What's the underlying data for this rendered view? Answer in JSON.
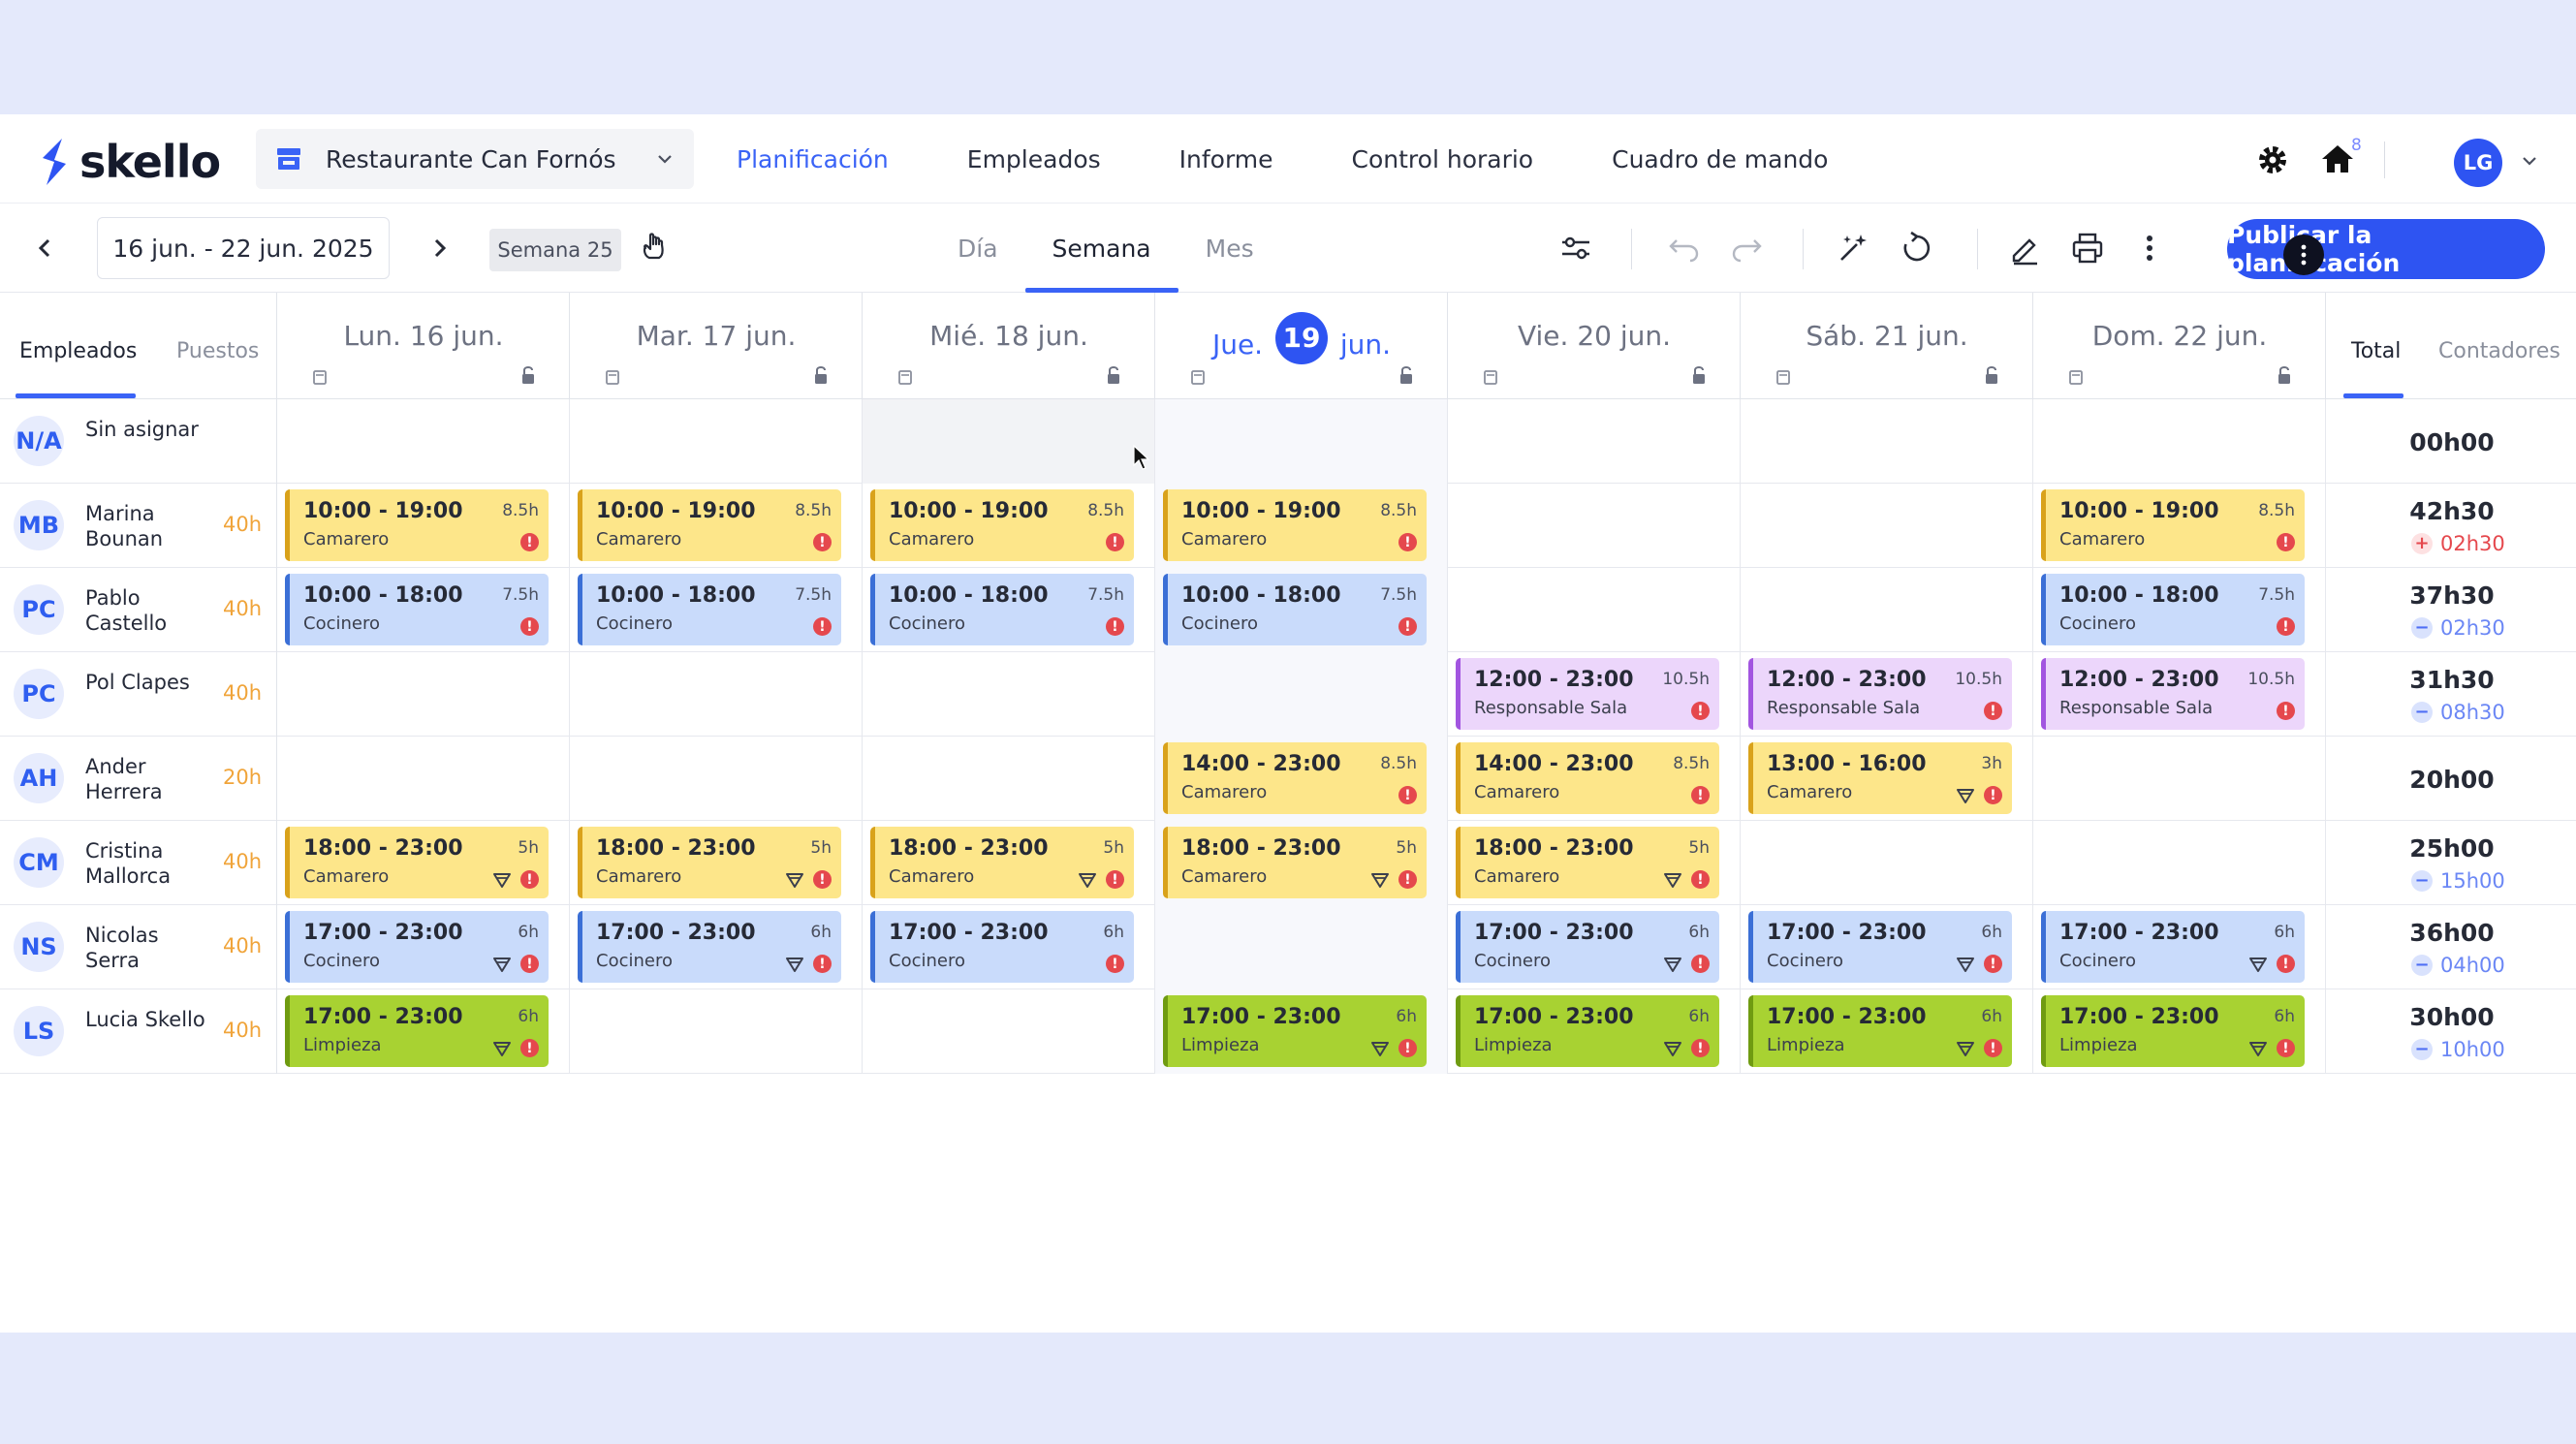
{
  "brand": {
    "name": "skello"
  },
  "store": {
    "name": "Restaurante Can Fornós"
  },
  "nav": [
    {
      "label": "Planificación",
      "active": true
    },
    {
      "label": "Empleados",
      "active": false
    },
    {
      "label": "Informe",
      "active": false
    },
    {
      "label": "Control horario",
      "active": false
    },
    {
      "label": "Cuadro de mando",
      "active": false
    }
  ],
  "notifications": {
    "count": "8"
  },
  "user": {
    "initials": "LG"
  },
  "toolbar": {
    "date_range": "16 jun. - 22 jun. 2025",
    "week": "Semana 25",
    "views": [
      {
        "label": "Día",
        "active": false
      },
      {
        "label": "Semana",
        "active": true
      },
      {
        "label": "Mes",
        "active": false
      }
    ],
    "publish_label": "Publicar la planificación"
  },
  "left_tabs": [
    {
      "label": "Empleados",
      "active": true
    },
    {
      "label": "Puestos",
      "active": false
    }
  ],
  "right_tabs": [
    {
      "label": "Total",
      "active": true
    },
    {
      "label": "Contadores",
      "active": false
    }
  ],
  "days": [
    {
      "name": "Lun.",
      "num": "16",
      "month": "jun.",
      "today": false
    },
    {
      "name": "Mar.",
      "num": "17",
      "month": "jun.",
      "today": false
    },
    {
      "name": "Mié.",
      "num": "18",
      "month": "jun.",
      "today": false
    },
    {
      "name": "Jue.",
      "num": "19",
      "month": "jun.",
      "today": true
    },
    {
      "name": "Vie.",
      "num": "20",
      "month": "jun.",
      "today": false
    },
    {
      "name": "Sáb.",
      "num": "21",
      "month": "jun.",
      "today": false
    },
    {
      "name": "Dom.",
      "num": "22",
      "month": "jun.",
      "today": false
    }
  ],
  "colors": {
    "accent": "#2e54f2",
    "yellow": "#fde68a",
    "blue": "#c9dbfb",
    "purple": "#ecd6fb",
    "green": "#a8d232",
    "warning": "#e5484d",
    "hours": "#f0a43a"
  },
  "employees": [
    {
      "initials": "N/A",
      "name": "Sin asignar",
      "hours": "",
      "total": "00h00",
      "diff": "",
      "diff_sign": "",
      "shifts": [
        null,
        null,
        null,
        null,
        null,
        null,
        null
      ]
    },
    {
      "initials": "MB",
      "name": "Marina Bounan",
      "hours": "40h",
      "total": "42h30",
      "diff": "02h30",
      "diff_sign": "plus",
      "shifts": [
        {
          "time": "10:00 - 19:00",
          "dur": "8.5h",
          "role": "Camarero",
          "color": "yellow",
          "meal": false
        },
        {
          "time": "10:00 - 19:00",
          "dur": "8.5h",
          "role": "Camarero",
          "color": "yellow",
          "meal": false
        },
        {
          "time": "10:00 - 19:00",
          "dur": "8.5h",
          "role": "Camarero",
          "color": "yellow",
          "meal": false
        },
        {
          "time": "10:00 - 19:00",
          "dur": "8.5h",
          "role": "Camarero",
          "color": "yellow",
          "meal": false
        },
        null,
        null,
        {
          "time": "10:00 - 19:00",
          "dur": "8.5h",
          "role": "Camarero",
          "color": "yellow",
          "meal": false
        }
      ]
    },
    {
      "initials": "PC",
      "name": "Pablo Castello",
      "hours": "40h",
      "total": "37h30",
      "diff": "02h30",
      "diff_sign": "minus",
      "shifts": [
        {
          "time": "10:00 - 18:00",
          "dur": "7.5h",
          "role": "Cocinero",
          "color": "blue",
          "meal": false
        },
        {
          "time": "10:00 - 18:00",
          "dur": "7.5h",
          "role": "Cocinero",
          "color": "blue",
          "meal": false
        },
        {
          "time": "10:00 - 18:00",
          "dur": "7.5h",
          "role": "Cocinero",
          "color": "blue",
          "meal": false
        },
        {
          "time": "10:00 - 18:00",
          "dur": "7.5h",
          "role": "Cocinero",
          "color": "blue",
          "meal": false
        },
        null,
        null,
        {
          "time": "10:00 - 18:00",
          "dur": "7.5h",
          "role": "Cocinero",
          "color": "blue",
          "meal": false
        }
      ]
    },
    {
      "initials": "PC",
      "name": "Pol Clapes",
      "hours": "40h",
      "total": "31h30",
      "diff": "08h30",
      "diff_sign": "minus",
      "shifts": [
        null,
        null,
        null,
        null,
        {
          "time": "12:00 - 23:00",
          "dur": "10.5h",
          "role": "Responsable Sala",
          "color": "purple",
          "meal": false
        },
        {
          "time": "12:00 - 23:00",
          "dur": "10.5h",
          "role": "Responsable Sala",
          "color": "purple",
          "meal": false
        },
        {
          "time": "12:00 - 23:00",
          "dur": "10.5h",
          "role": "Responsable Sala",
          "color": "purple",
          "meal": false
        }
      ]
    },
    {
      "initials": "AH",
      "name": "Ander Herrera",
      "hours": "20h",
      "total": "20h00",
      "diff": "",
      "diff_sign": "",
      "shifts": [
        null,
        null,
        null,
        {
          "time": "14:00 - 23:00",
          "dur": "8.5h",
          "role": "Camarero",
          "color": "yellow",
          "meal": false
        },
        {
          "time": "14:00 - 23:00",
          "dur": "8.5h",
          "role": "Camarero",
          "color": "yellow",
          "meal": false
        },
        {
          "time": "13:00 - 16:00",
          "dur": "3h",
          "role": "Camarero",
          "color": "yellow",
          "meal": true
        },
        null
      ]
    },
    {
      "initials": "CM",
      "name": "Cristina Mallorca",
      "hours": "40h",
      "total": "25h00",
      "diff": "15h00",
      "diff_sign": "minus",
      "shifts": [
        {
          "time": "18:00 - 23:00",
          "dur": "5h",
          "role": "Camarero",
          "color": "yellow",
          "meal": true
        },
        {
          "time": "18:00 - 23:00",
          "dur": "5h",
          "role": "Camarero",
          "color": "yellow",
          "meal": true
        },
        {
          "time": "18:00 - 23:00",
          "dur": "5h",
          "role": "Camarero",
          "color": "yellow",
          "meal": true
        },
        {
          "time": "18:00 - 23:00",
          "dur": "5h",
          "role": "Camarero",
          "color": "yellow",
          "meal": true
        },
        {
          "time": "18:00 - 23:00",
          "dur": "5h",
          "role": "Camarero",
          "color": "yellow",
          "meal": true
        },
        null,
        null
      ]
    },
    {
      "initials": "NS",
      "name": "Nicolas Serra",
      "hours": "40h",
      "total": "36h00",
      "diff": "04h00",
      "diff_sign": "minus",
      "shifts": [
        {
          "time": "17:00 - 23:00",
          "dur": "6h",
          "role": "Cocinero",
          "color": "blue",
          "meal": true
        },
        {
          "time": "17:00 - 23:00",
          "dur": "6h",
          "role": "Cocinero",
          "color": "blue",
          "meal": true
        },
        {
          "time": "17:00 - 23:00",
          "dur": "6h",
          "role": "Cocinero",
          "color": "blue",
          "meal": false
        },
        null,
        {
          "time": "17:00 - 23:00",
          "dur": "6h",
          "role": "Cocinero",
          "color": "blue",
          "meal": true
        },
        {
          "time": "17:00 - 23:00",
          "dur": "6h",
          "role": "Cocinero",
          "color": "blue",
          "meal": true
        },
        {
          "time": "17:00 - 23:00",
          "dur": "6h",
          "role": "Cocinero",
          "color": "blue",
          "meal": true
        }
      ]
    },
    {
      "initials": "LS",
      "name": "Lucia Skello",
      "hours": "40h",
      "total": "30h00",
      "diff": "10h00",
      "diff_sign": "minus",
      "shifts": [
        {
          "time": "17:00 - 23:00",
          "dur": "6h",
          "role": "Limpieza",
          "color": "green",
          "meal": true
        },
        null,
        null,
        {
          "time": "17:00 - 23:00",
          "dur": "6h",
          "role": "Limpieza",
          "color": "green",
          "meal": true
        },
        {
          "time": "17:00 - 23:00",
          "dur": "6h",
          "role": "Limpieza",
          "color": "green",
          "meal": true
        },
        {
          "time": "17:00 - 23:00",
          "dur": "6h",
          "role": "Limpieza",
          "color": "green",
          "meal": true
        },
        {
          "time": "17:00 - 23:00",
          "dur": "6h",
          "role": "Limpieza",
          "color": "green",
          "meal": true
        }
      ]
    }
  ]
}
